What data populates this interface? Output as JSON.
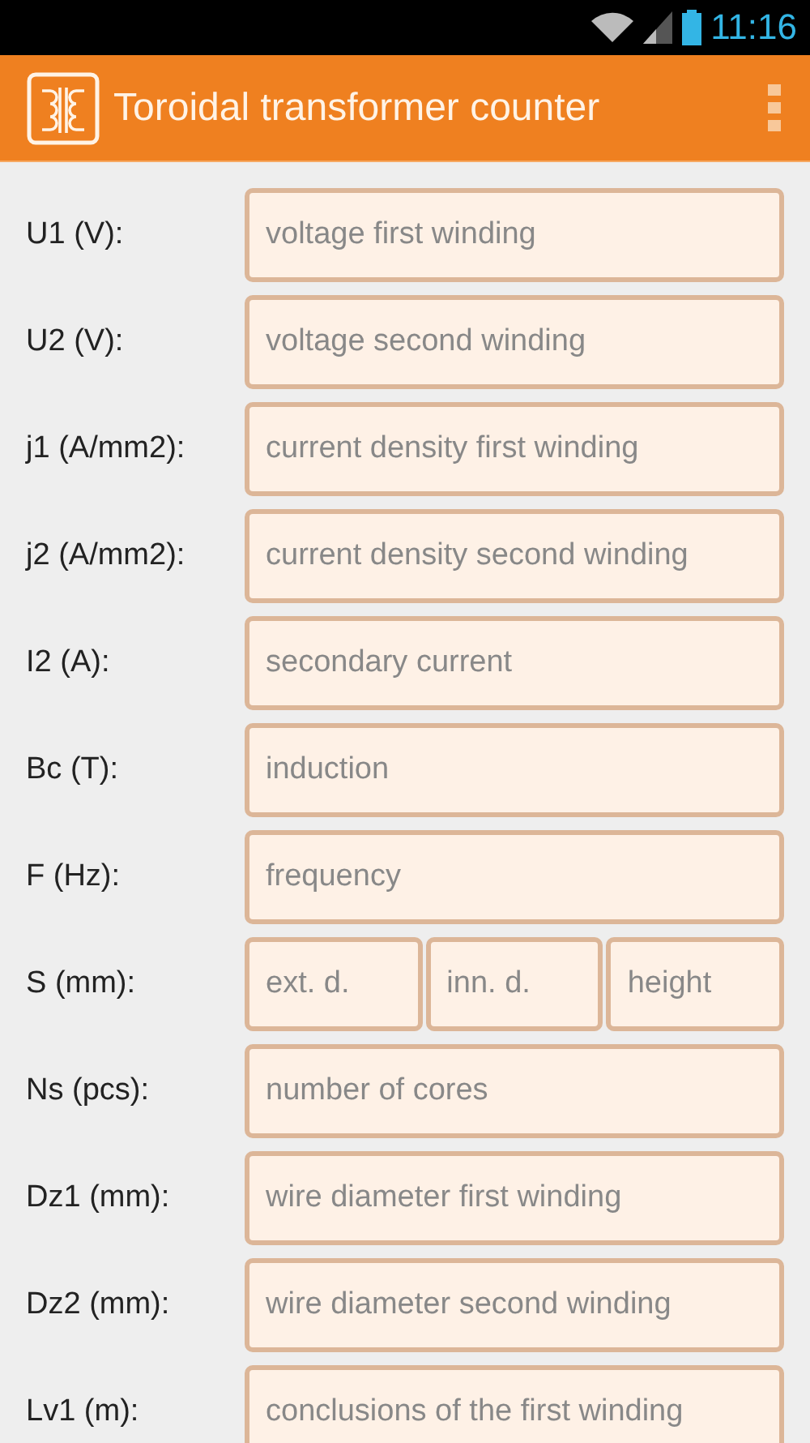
{
  "status_bar": {
    "time": "11:16"
  },
  "app_bar": {
    "title": "Toroidal transformer counter"
  },
  "rows": [
    {
      "label": "U1 (V):",
      "fields": [
        {
          "placeholder": "voltage first winding"
        }
      ]
    },
    {
      "label": "U2 (V):",
      "fields": [
        {
          "placeholder": "voltage second winding"
        }
      ]
    },
    {
      "label": "j1 (A/mm2):",
      "fields": [
        {
          "placeholder": "current density first winding"
        }
      ]
    },
    {
      "label": "j2 (A/mm2):",
      "fields": [
        {
          "placeholder": "current density second winding"
        }
      ]
    },
    {
      "label": "I2 (A):",
      "fields": [
        {
          "placeholder": "secondary current"
        }
      ]
    },
    {
      "label": "Bc (T):",
      "fields": [
        {
          "placeholder": "induction"
        }
      ]
    },
    {
      "label": "F (Hz):",
      "fields": [
        {
          "placeholder": "frequency"
        }
      ]
    },
    {
      "label": "S (mm):",
      "fields": [
        {
          "placeholder": "ext. d."
        },
        {
          "placeholder": "inn. d."
        },
        {
          "placeholder": "height"
        }
      ]
    },
    {
      "label": "Ns (pcs):",
      "fields": [
        {
          "placeholder": "number of cores"
        }
      ]
    },
    {
      "label": "Dz1 (mm):",
      "fields": [
        {
          "placeholder": "wire diameter first winding"
        }
      ]
    },
    {
      "label": "Dz2 (mm):",
      "fields": [
        {
          "placeholder": "wire diameter second winding"
        }
      ]
    },
    {
      "label": "Lv1 (m):",
      "fields": [
        {
          "placeholder": "conclusions of the first winding"
        }
      ]
    }
  ]
}
